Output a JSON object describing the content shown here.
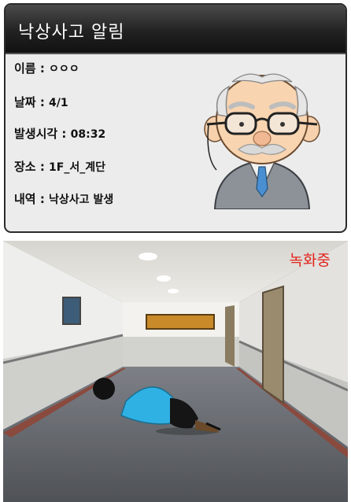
{
  "alert": {
    "title": "낙상사고 알림",
    "fields": [
      {
        "label": "이름 : ",
        "value": "ㅇㅇㅇ"
      },
      {
        "label": "날짜 : ",
        "value": "4/1"
      },
      {
        "label": "발생시각 : ",
        "value": "08:32"
      },
      {
        "label": "장소 : ",
        "value": "1F_서_계단"
      },
      {
        "label": "내역 : ",
        "value": "낙상사고 발생"
      }
    ],
    "avatar_icon": "elderly-man-icon"
  },
  "camera": {
    "recording_label": "녹화중",
    "recording_color": "#e3231b"
  }
}
